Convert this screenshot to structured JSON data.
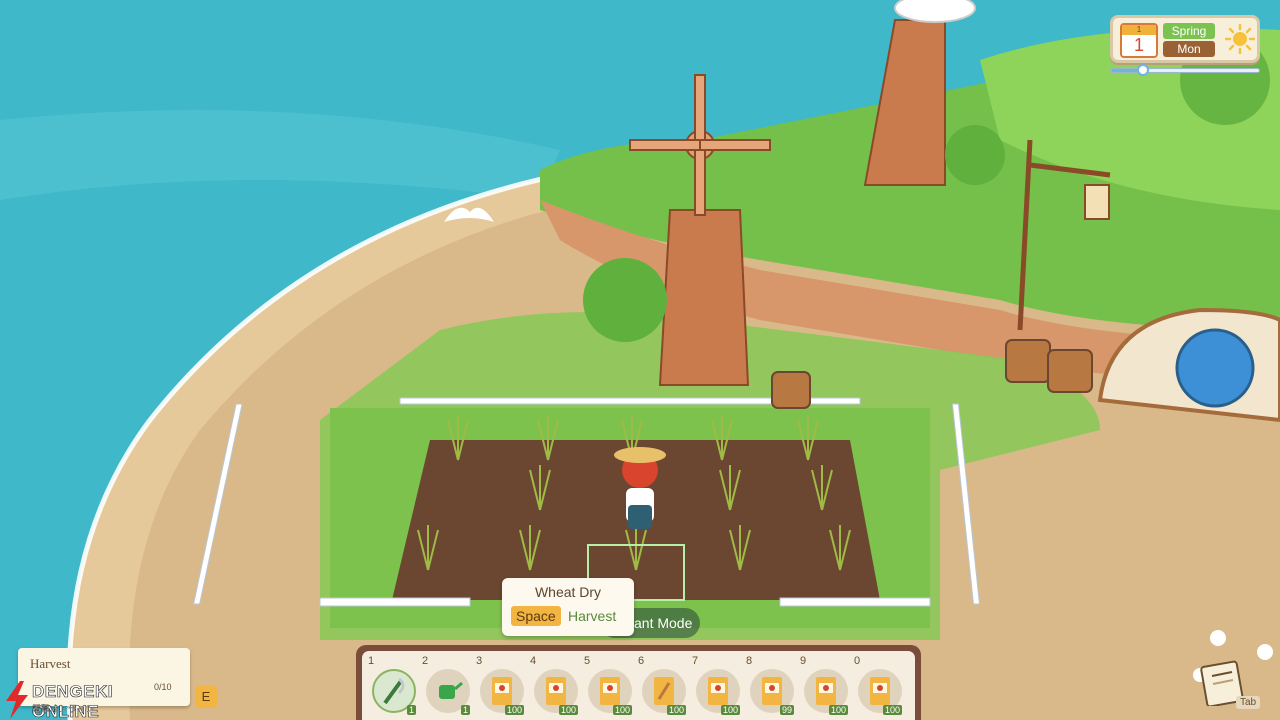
{
  "hud": {
    "calendar": {
      "month": "1",
      "day": "1",
      "season": "Spring",
      "weekday": "Mon",
      "weather_icon": "sun-icon"
    },
    "time_progress": 0.22
  },
  "tooltip": {
    "item_name": "Wheat Dry",
    "key": "Space",
    "action": "Harvest",
    "mode_label": "ant Mode"
  },
  "quest": {
    "label": "Harvest",
    "progress": "0/10",
    "key": "E"
  },
  "hotbar": {
    "slots": [
      {
        "number": "1",
        "icon": "sickle-icon",
        "qty": "1",
        "selected": true
      },
      {
        "number": "2",
        "icon": "watering-can-icon",
        "qty": "1",
        "selected": false
      },
      {
        "number": "3",
        "icon": "seed-packet-icon",
        "qty": "100",
        "selected": false
      },
      {
        "number": "4",
        "icon": "seed-packet-icon",
        "qty": "100",
        "selected": false
      },
      {
        "number": "5",
        "icon": "seed-packet-icon",
        "qty": "100",
        "selected": false
      },
      {
        "number": "6",
        "icon": "wheat-seed-packet-icon",
        "qty": "100",
        "selected": false
      },
      {
        "number": "7",
        "icon": "seed-packet-icon",
        "qty": "100",
        "selected": false
      },
      {
        "number": "8",
        "icon": "seed-packet-icon",
        "qty": "99",
        "selected": false
      },
      {
        "number": "9",
        "icon": "seed-packet-icon",
        "qty": "100",
        "selected": false
      },
      {
        "number": "0",
        "icon": "seed-packet-icon",
        "qty": "100",
        "selected": false
      }
    ]
  },
  "journal": {
    "tab_key": "Tab"
  },
  "watermark": {
    "main": "DENGEKI ONLINE",
    "sub": "電撃オンライン"
  },
  "colors": {
    "sea": "#3fb8c9",
    "sand": "#d9b989",
    "grass": "#7cc250",
    "soil": "#6b4631",
    "accent": "#f2b541"
  }
}
